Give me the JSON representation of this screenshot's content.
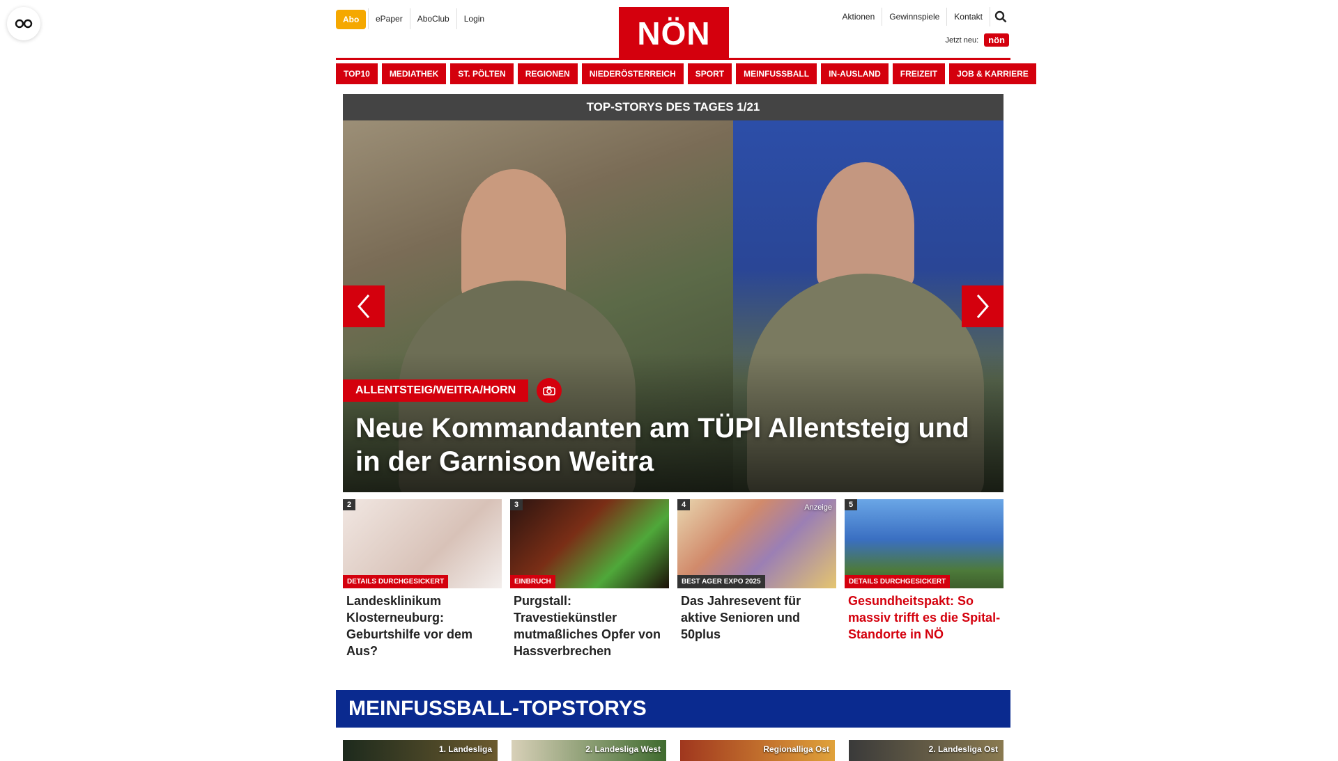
{
  "overlay": {
    "icon": "glasses-icon"
  },
  "header": {
    "abo_label": "Abo",
    "links": [
      "ePaper",
      "AboClub",
      "Login"
    ],
    "logo_text": "NÖN",
    "right_links": [
      "Aktionen",
      "Gewinnspiele",
      "Kontakt"
    ],
    "search_icon": "search-icon",
    "new_label": "Jetzt neu:",
    "new_logo_text": "nön",
    "accent_color": "#d4000d"
  },
  "nav": [
    "TOP10",
    "MEDIATHEK",
    "ST. PÖLTEN",
    "REGIONEN",
    "NIEDERÖSTERREICH",
    "SPORT",
    "MEINFUSSBALL",
    "IN-AUSLAND",
    "FREIZEIT",
    "JOB & KARRIERE"
  ],
  "hero": {
    "heading": "TOP-STORYS DES TAGES 1/21",
    "category": "ALLENTSTEIG/WEITRA/HORN",
    "title": "Neue Kommandanten am TÜPl Allentsteig und in der Garnison Weitra",
    "prev_icon": "chevron-left-icon",
    "next_icon": "chevron-right-icon",
    "camera_icon": "camera-icon"
  },
  "teasers": [
    {
      "num": "2",
      "tag": "DETAILS DURCHGESICKERT",
      "title": "Landesklinikum Klosterneuburg: Geburtshilfe vor dem Aus?",
      "ad": ""
    },
    {
      "num": "3",
      "tag": "EINBRUCH",
      "title": "Purgstall: Travestiekünstler mutmaßliches Opfer von Hassverbrechen",
      "ad": ""
    },
    {
      "num": "4",
      "tag": "BEST AGER EXPO 2025",
      "title": "Das Jahresevent für aktive Senioren und 50plus",
      "ad": "Anzeige"
    },
    {
      "num": "5",
      "tag": "DETAILS DURCHGESICKERT",
      "title": "Gesundheitspakt: So massiv trifft es die Spital-Standorte in NÖ",
      "ad": ""
    }
  ],
  "section": {
    "title": "MEINFUSSBALL-TOPSTORYS",
    "color": "#0a2a8f",
    "labels": [
      "1. Landesliga",
      "2. Landesliga West",
      "Regionalliga Ost",
      "2. Landesliga Ost"
    ]
  }
}
